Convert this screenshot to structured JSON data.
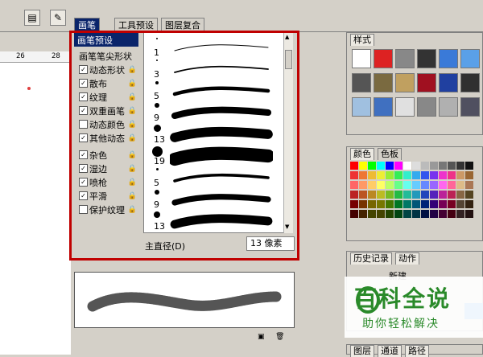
{
  "toolbar": {
    "icon1": "document-icon",
    "icon2": "brush-palette-icon"
  },
  "tabs": [
    {
      "label": "画笔",
      "active": true
    },
    {
      "label": "工具预设",
      "active": false
    },
    {
      "label": "图层复合",
      "active": false
    }
  ],
  "ruler": {
    "label_a": "26",
    "label_b": "28"
  },
  "brush_options": {
    "preset_label": "画笔预设",
    "tip_shape_label": "画笔笔尖形状",
    "items": [
      {
        "label": "动态形状",
        "checked": true
      },
      {
        "label": "散布",
        "checked": true
      },
      {
        "label": "纹理",
        "checked": true
      },
      {
        "label": "双重画笔",
        "checked": true
      },
      {
        "label": "动态颜色",
        "checked": false
      },
      {
        "label": "其他动态",
        "checked": true
      },
      {
        "label": "杂色",
        "checked": true
      },
      {
        "label": "湿边",
        "checked": true
      },
      {
        "label": "喷枪",
        "checked": true
      },
      {
        "label": "平滑",
        "checked": true
      },
      {
        "label": "保护纹理",
        "checked": false
      }
    ]
  },
  "presets": [
    {
      "size": "1",
      "thickness": 1
    },
    {
      "size": "3",
      "thickness": 2
    },
    {
      "size": "5",
      "thickness": 5
    },
    {
      "size": "9",
      "thickness": 9
    },
    {
      "size": "13",
      "thickness": 13
    },
    {
      "size": "19",
      "thickness": 18
    },
    {
      "size": "5",
      "thickness": 4
    },
    {
      "size": "9",
      "thickness": 8
    },
    {
      "size": "13",
      "thickness": 12
    }
  ],
  "diameter": {
    "label": "主直径(D)",
    "value": "13 像素"
  },
  "right_panels": {
    "styles_tab": "样式",
    "color_tab": "颜色",
    "swatches_tab": "色板",
    "history_tab": "历史记录",
    "actions_tab": "动作",
    "history_item": "新建",
    "layers_tab": "图层",
    "channels_tab": "通道",
    "paths_tab": "路径"
  },
  "watermark": {
    "title": "百科全说",
    "subtitle": "助你轻松解决"
  },
  "colors": {
    "accent": "#c00000",
    "tab_active": "#0a246a",
    "watermark_text": "#2a8a2a"
  }
}
